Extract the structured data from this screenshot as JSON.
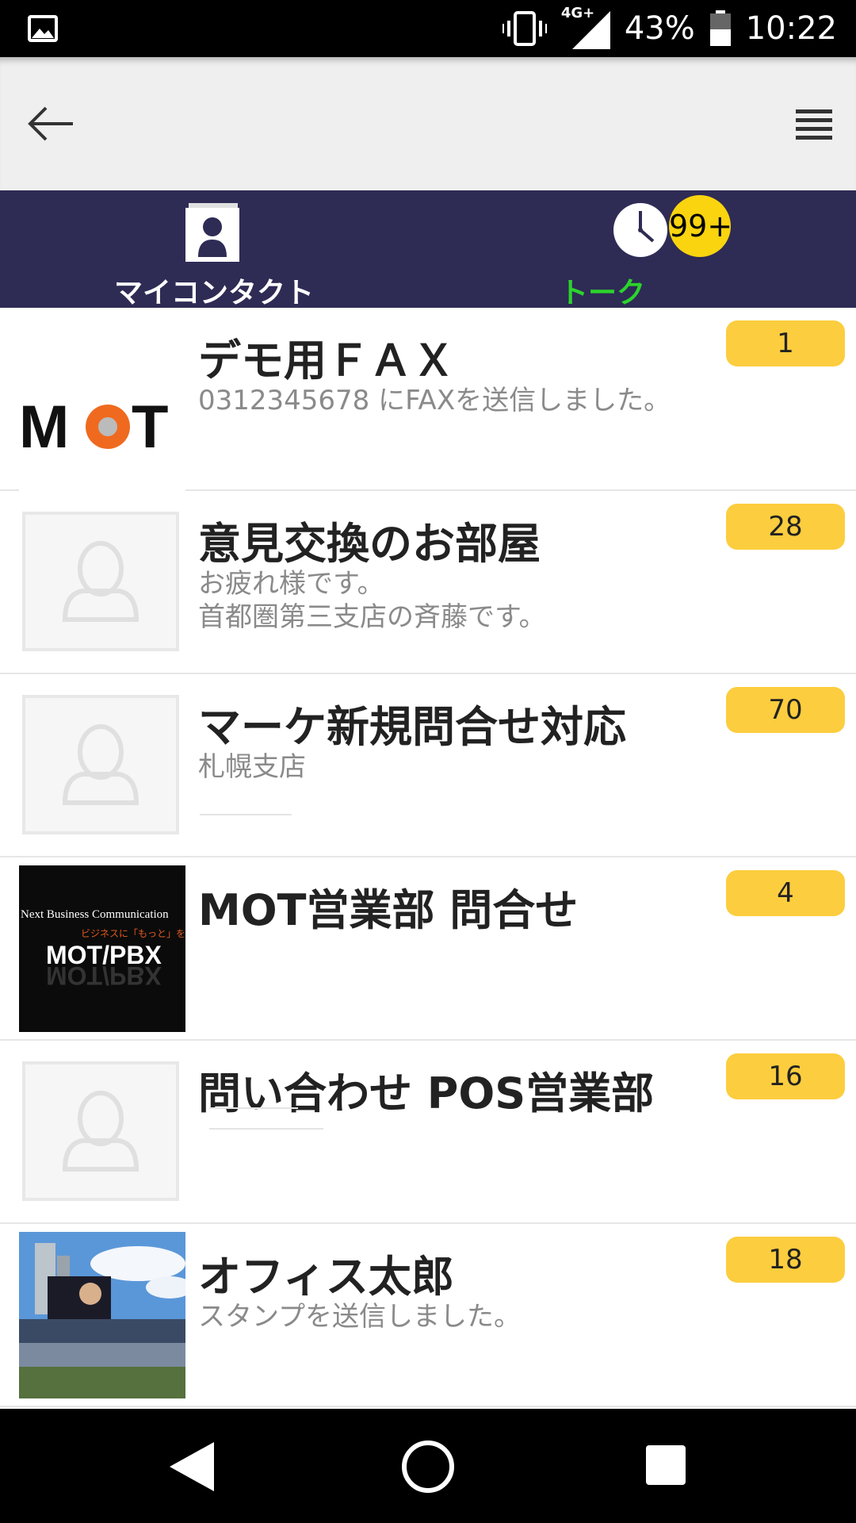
{
  "status_bar": {
    "network": "4G+",
    "battery": "43%",
    "time": "10:22"
  },
  "tabs": [
    {
      "label": "マイコンタクト",
      "icon": "contact-book-icon",
      "active": false
    },
    {
      "label": "トーク",
      "icon": "clock-icon",
      "active": true,
      "badge": "99+"
    }
  ],
  "colors": {
    "tabbar_bg": "#2e2b55",
    "active_tab": "#2bd42b",
    "count_badge": "#fccd3e",
    "notification_badge": "#f9d40f"
  },
  "conversations": [
    {
      "title": "デモ用ＦＡＸ",
      "subtitle": "0312345678 にFAXを送信しました。",
      "count": "1",
      "avatar": "mot-logo"
    },
    {
      "title": "意見交換のお部屋",
      "subtitle": "お疲れ様です。\n首都圏第三支店の斉藤です。",
      "count": "28",
      "avatar": "placeholder"
    },
    {
      "title": "マーケ新規問合せ対応",
      "subtitle": "札幌支店",
      "count": "70",
      "avatar": "placeholder"
    },
    {
      "title": "MOT営業部 問合せ",
      "subtitle": "",
      "count": "4",
      "avatar": "mot-pbx-banner",
      "avatar_text": {
        "line1": "Next Business Communication",
        "line2": "ビジネスに「もっと」を!!",
        "line3": "MOT/PBX"
      }
    },
    {
      "title": "問い合わせ POS営業部",
      "subtitle": "",
      "count": "16",
      "avatar": "placeholder"
    },
    {
      "title": "オフィス太郎",
      "subtitle": "スタンプを送信しました。",
      "count": "18",
      "avatar": "stadium-photo"
    }
  ]
}
